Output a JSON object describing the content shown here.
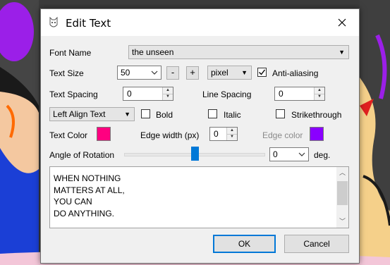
{
  "window": {
    "title": "Edit Text"
  },
  "font": {
    "label": "Font Name",
    "value": "the unseen"
  },
  "text_size": {
    "label": "Text Size",
    "value": "50",
    "decrease": "-",
    "increase": "+",
    "unit": "pixel",
    "antialias_label": "Anti-aliasing",
    "antialias_checked": true
  },
  "text_spacing": {
    "label": "Text Spacing",
    "value": "0"
  },
  "line_spacing": {
    "label": "Line Spacing",
    "value": "0"
  },
  "align": {
    "value": "Left Align Text"
  },
  "bold": {
    "label": "Bold",
    "checked": false
  },
  "italic": {
    "label": "Italic",
    "checked": false
  },
  "strikethrough": {
    "label": "Strikethrough",
    "checked": false
  },
  "text_color": {
    "label": "Text Color",
    "color": "#ff0080"
  },
  "edge_width": {
    "label": "Edge width (px)",
    "value": "0"
  },
  "edge_color": {
    "label": "Edge color",
    "color": "#8a00ff"
  },
  "rotation": {
    "label": "Angle of Rotation",
    "value": "0",
    "unit": "deg.",
    "slider_fraction": 0.5
  },
  "text_body": "WHEN NOTHING\nMATTERS AT ALL,\nYOU CAN\nDO ANYTHING.",
  "buttons": {
    "ok": "OK",
    "cancel": "Cancel"
  },
  "colors": {
    "accent": "#0078d7"
  }
}
